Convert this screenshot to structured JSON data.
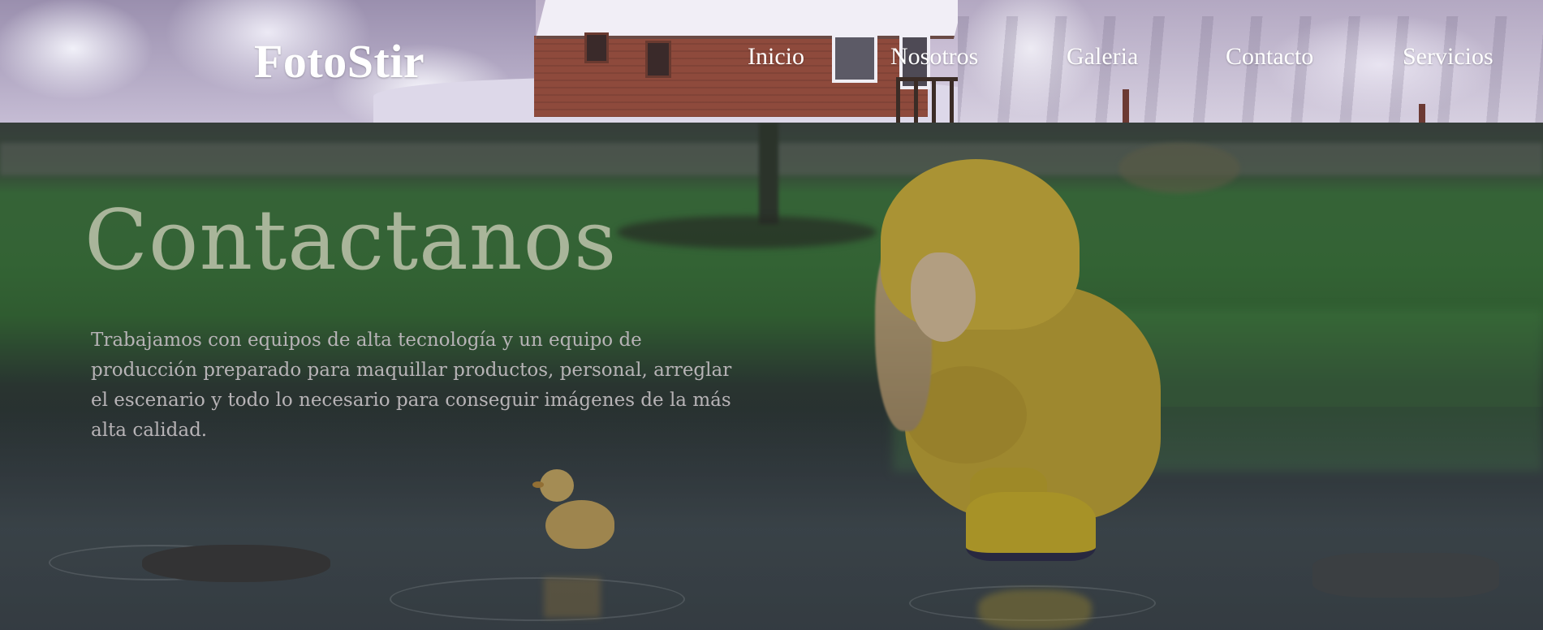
{
  "header": {
    "logo": "FotoStir",
    "nav": [
      {
        "label": "Inicio"
      },
      {
        "label": "Nosotros"
      },
      {
        "label": "Galeria"
      },
      {
        "label": "Contacto"
      },
      {
        "label": "Servicios"
      }
    ]
  },
  "hero": {
    "title": "Contactanos",
    "paragraph": "Trabajamos con equipos de alta tecnología y un equipo de producción preparado para maquillar productos, personal, arreglar el escenario y todo lo necesario para conseguir imágenes de la más alta calidad."
  },
  "colors": {
    "nav_text": "#ffffff",
    "title_text": "#a9b59a",
    "paragraph_text": "#b7b3b6"
  }
}
